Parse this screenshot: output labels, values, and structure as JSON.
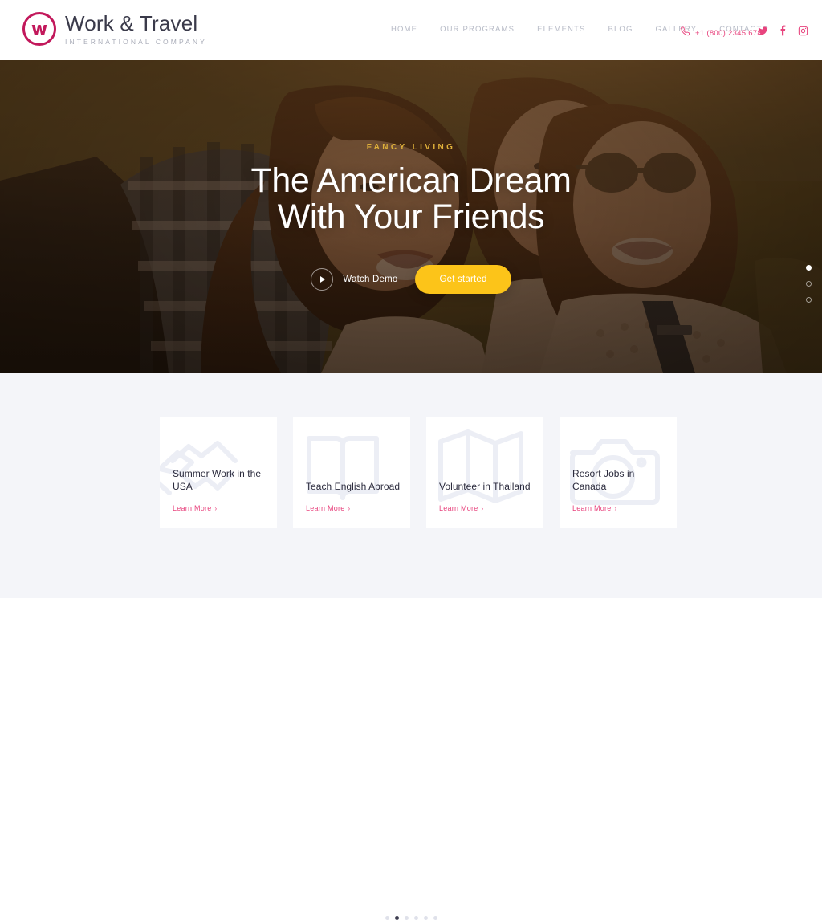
{
  "brand": {
    "name": "Work & Travel",
    "tagline": "INTERNATIONAL COMPANY",
    "mark_letter": "w",
    "mark_color": "#c2185b"
  },
  "nav": {
    "items": [
      {
        "label": "HOME"
      },
      {
        "label": "OUR PROGRAMS"
      },
      {
        "label": "ELEMENTS"
      },
      {
        "label": "BLOG"
      },
      {
        "label": "GALLERY"
      },
      {
        "label": "CONTACTS"
      }
    ]
  },
  "contact": {
    "phone": "+1 (800) 2345 678",
    "phone_icon": "phone-icon",
    "phone_color": "#e8447e"
  },
  "socials": [
    {
      "name": "twitter-icon",
      "label": "Twitter"
    },
    {
      "name": "facebook-icon",
      "label": "Facebook"
    },
    {
      "name": "instagram-icon",
      "label": "Instagram"
    }
  ],
  "hero": {
    "eyebrow": "FANCY LIVING",
    "title_line1": "The American Dream",
    "title_line2": "With Your Friends",
    "eyebrow_color": "#e0b13a",
    "watch_label": "Watch Demo",
    "watch_icon": "play-circle-icon",
    "cta_label": "Get started",
    "cta_color": "#fcc419",
    "slider_dots": 3,
    "slider_active_index": 0
  },
  "programs": {
    "cards": [
      {
        "title": "Summer Work in the USA",
        "link_label": "Learn More",
        "icon": "handshake-icon"
      },
      {
        "title": "Teach English Abroad",
        "link_label": "Learn More",
        "icon": "open-book-icon"
      },
      {
        "title": "Volunteer in Thailand",
        "link_label": "Learn More",
        "icon": "map-icon"
      },
      {
        "title": "Resort Jobs in Canada",
        "link_label": "Learn More",
        "icon": "camera-icon"
      }
    ],
    "link_color": "#e8447e",
    "chevron": "›",
    "pager_dots": 6,
    "pager_active_index": 1,
    "section_background": "#f4f5f9"
  }
}
